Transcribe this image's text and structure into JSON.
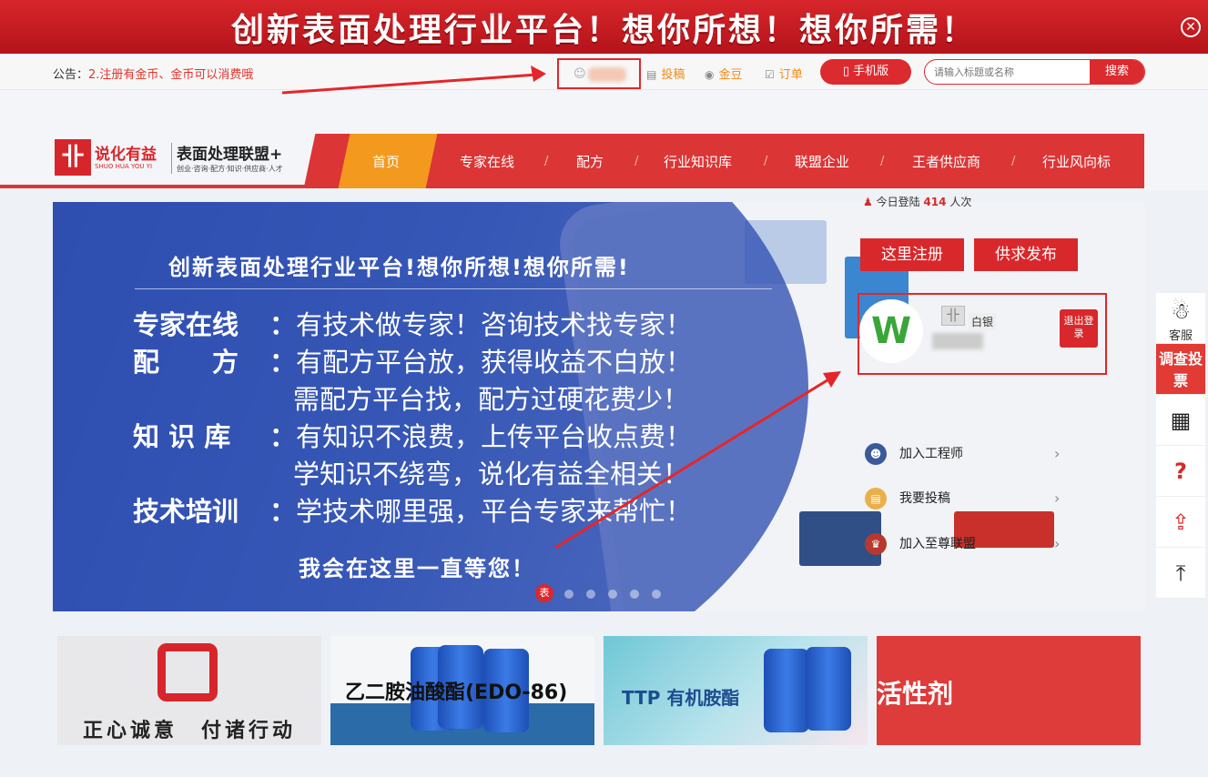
{
  "top_banner": {
    "text": "创新表面处理行业平台！想你所想！想你所需！",
    "close": "✕"
  },
  "toolbar": {
    "notice_label": "公告：",
    "notice_text": "2.注册有金币、金币可以消费哦",
    "user_icon": "user-icon",
    "submit": "投稿",
    "gold": "金豆",
    "orders": "订单",
    "mobile": "手机版",
    "search_placeholder": "请输入标题或名称",
    "search_button": "搜索"
  },
  "logo": {
    "name_cn": "说化有益",
    "name_en": "SHUO HUA YOU YI",
    "title": "表面处理联盟+",
    "subtitle": "创业·咨询·配方·知识·供应商·人才"
  },
  "nav": {
    "items": [
      "首页",
      "专家在线",
      "配方",
      "行业知识库",
      "联盟企业",
      "王者供应商",
      "行业风向标"
    ],
    "separator": "/"
  },
  "hero": {
    "title": "创新表面处理行业平台!想你所想!想你所需!",
    "lines": [
      {
        "key": "专家在线",
        "colon": "：",
        "value": "有技术做专家！咨询技术找专家！"
      },
      {
        "key": "配　　方",
        "colon": "：",
        "value": "有配方平台放，获得收益不白放！"
      },
      {
        "key": "",
        "colon": "",
        "value": "需配方平台找，配方过硬花费少！"
      },
      {
        "key": "知 识 库",
        "colon": "：",
        "value": "有知识不浪费，上传平台收点费！"
      },
      {
        "key": "",
        "colon": "",
        "value": "学知识不绕弯，说化有益全相关！"
      },
      {
        "key": "技术培训",
        "colon": "：",
        "value": "学技术哪里强，平台专家来帮忙！"
      }
    ],
    "footer": "我会在这里一直等您！",
    "dot_active_label": "表",
    "register_btn": "这里注册",
    "publish_btn": "供求发布",
    "avatar_letter": "W",
    "level": "白银",
    "logout": "退出登录",
    "today_prefix": "今日登陆",
    "today_count": "414",
    "today_suffix": "人次",
    "links": [
      "加入工程师",
      "我要投稿",
      "加入至尊联盟"
    ]
  },
  "float_bar": {
    "qq": "客服",
    "vote": "调查投票",
    "help": "?",
    "share_icon": "share-icon",
    "top_icon": "back-to-top-icon"
  },
  "tiles": {
    "t1": "正心诚意　付诸行动",
    "t2": "乙二胺油酸酯(EDO-86)",
    "t3": "TTP 有机胺酯",
    "t4": "活性剂"
  }
}
